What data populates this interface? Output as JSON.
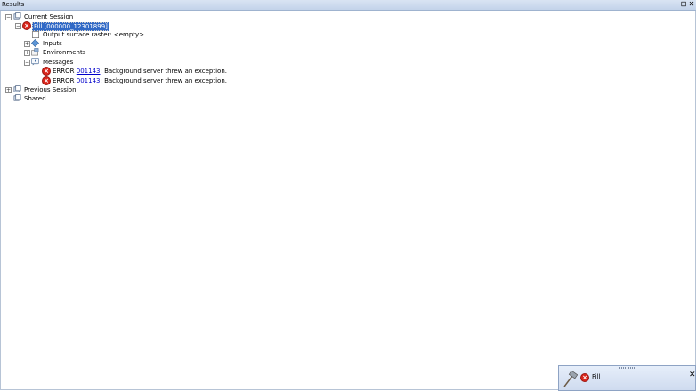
{
  "window": {
    "title": "Results",
    "pin_glyph": "⊡",
    "close_glyph": "✕"
  },
  "tree": {
    "current_session": "Current Session",
    "fill_item": "Fill [000000_12301899]",
    "output": "Output surface raster: <empty>",
    "inputs": "Inputs",
    "environments": "Environments",
    "messages": "Messages",
    "errors": [
      {
        "prefix": "ERROR ",
        "code": "001143",
        "text": ": Background server threw an exception."
      },
      {
        "prefix": "ERROR ",
        "code": "001143",
        "text": ": Background server threw an exception."
      }
    ],
    "previous_session": "Previous Session",
    "shared": "Shared"
  },
  "popup": {
    "label": "Fill",
    "close_glyph": "✕"
  },
  "colors": {
    "selection": "#3169c6",
    "error": "#d9261c",
    "link": "#0000cc",
    "title_bar": "#c3d3ea"
  }
}
